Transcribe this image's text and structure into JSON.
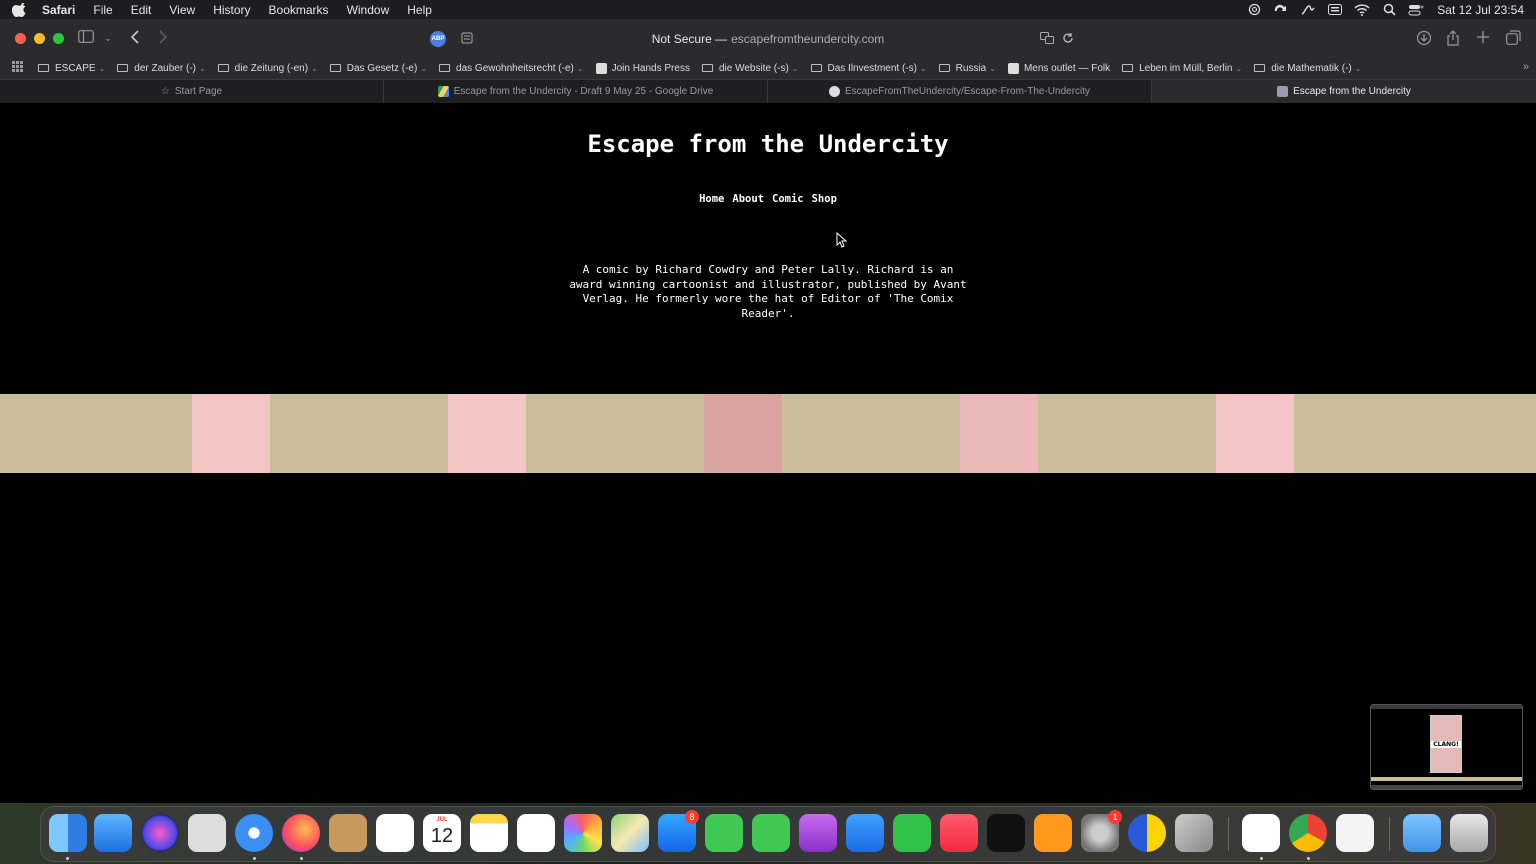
{
  "menubar": {
    "app_name": "Safari",
    "items": [
      "File",
      "Edit",
      "View",
      "History",
      "Bookmarks",
      "Window",
      "Help"
    ],
    "clock": "Sat 12 Jul  23:54"
  },
  "toolbar": {
    "url_security": "Not Secure —",
    "url_host": "escapefromtheundercity.com",
    "adblock_label": "ABP"
  },
  "bookmarks": [
    {
      "label": "ESCAPE",
      "type": "folder"
    },
    {
      "label": "der Zauber (-)",
      "type": "folder"
    },
    {
      "label": "die Zeitung (-en)",
      "type": "folder"
    },
    {
      "label": "Das Gesetz (-e)",
      "type": "folder"
    },
    {
      "label": "das Gewohnheitsrecht (-e)",
      "type": "folder"
    },
    {
      "label": "Join Hands Press",
      "type": "link"
    },
    {
      "label": "die Website (-s)",
      "type": "folder"
    },
    {
      "label": "Das Ilnvestment (-s)",
      "type": "folder"
    },
    {
      "label": "Russia",
      "type": "folder"
    },
    {
      "label": "Mens outlet — Folk",
      "type": "link"
    },
    {
      "label": "Leben im Müll, Berlin",
      "type": "folder"
    },
    {
      "label": "die Mathematik (-)",
      "type": "folder"
    }
  ],
  "tabs": [
    {
      "label": "Start Page",
      "active": false
    },
    {
      "label": "Escape from the Undercity - Draft 9 May 25 - Google Drive",
      "active": false
    },
    {
      "label": "EscapeFromTheUndercity/Escape-From-The-Undercity",
      "active": false
    },
    {
      "label": "Escape from the Undercity",
      "active": true
    }
  ],
  "page": {
    "title": "Escape from the Undercity",
    "nav": [
      "Home",
      "About",
      "Comic",
      "Shop"
    ],
    "intro": "A comic by Richard Cowdry and Peter Lally. Richard is an award winning cartoonist and illustrator, published by Avant Verlag. He formerly wore the hat of Editor of 'The Comix Reader'.",
    "strip_colors": {
      "base": "#c9bd9b",
      "tiles": [
        "#f2c4c4",
        "#f4c6c6",
        "#d9a3a0",
        "#eab8b9",
        "#f4c4c6"
      ]
    }
  },
  "thumbnail": {
    "word": "CLANG!"
  },
  "dock": {
    "apps": [
      "finder-icon",
      "mail-icon",
      "siri-icon",
      "launchpad-icon",
      "safari-icon",
      "firefox-icon",
      "contacts-icon",
      "reminders-icon",
      "calendar-icon",
      "notes-icon",
      "freeform-icon",
      "photos-icon",
      "maps-icon",
      "app-store-icon",
      "facetime-icon",
      "messages-icon",
      "podcasts-icon",
      "keynote-icon",
      "numbers-icon",
      "music-icon",
      "apple-tv-icon",
      "books-icon",
      "system-settings-icon",
      "app-icon-yellow-blue",
      "app-icon-pages-like",
      "chatgpt-icon",
      "chrome-icon",
      "textedit-icon",
      "folder-icon",
      "trash-icon"
    ],
    "calendar_month": "JUL",
    "calendar_day": "12",
    "app_store_badge": "8",
    "settings_badge": "1"
  }
}
